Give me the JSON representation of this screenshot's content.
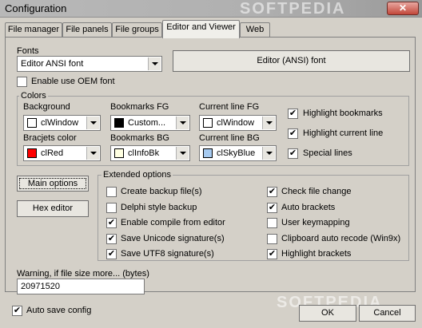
{
  "window": {
    "title": "Configuration",
    "close_glyph": "✕"
  },
  "tabs": [
    {
      "label": "File manager",
      "active": false
    },
    {
      "label": "File panels",
      "active": false
    },
    {
      "label": "File groups",
      "active": false
    },
    {
      "label": "Editor and Viewer",
      "active": true
    },
    {
      "label": "Web",
      "active": false
    }
  ],
  "fonts": {
    "label": "Fonts",
    "selected": "Editor ANSI font",
    "font_button": "Editor (ANSI) font",
    "oem_checkbox": {
      "label": "Enable use OEM font",
      "checked": false
    }
  },
  "colors": {
    "label": "Colors",
    "fields": [
      {
        "label": "Background",
        "value": "clWindow",
        "swatch": "#ffffff"
      },
      {
        "label": "Bookmarks FG",
        "value": "Custom...",
        "swatch": "#000000"
      },
      {
        "label": "Current line FG",
        "value": "clWindow",
        "swatch": "#ffffff"
      },
      {
        "label": "Bracjets color",
        "value": "clRed",
        "swatch": "#ff0000"
      },
      {
        "label": "Bookmarks BG",
        "value": "clInfoBk",
        "swatch": "#ffffe1"
      },
      {
        "label": "Current line BG",
        "value": "clSkyBlue",
        "swatch": "#a6caf0"
      }
    ],
    "checks": [
      {
        "label": "Highlight bookmarks",
        "checked": true
      },
      {
        "label": "Highlight current line",
        "checked": true
      },
      {
        "label": "Special lines",
        "checked": true
      }
    ]
  },
  "buttons": {
    "main_options": "Main options",
    "hex_editor": "Hex editor"
  },
  "extended": {
    "label": "Extended options",
    "left": [
      {
        "label": "Create backup file(s)",
        "checked": false
      },
      {
        "label": "Delphi style backup",
        "checked": false
      },
      {
        "label": "Enable compile from editor",
        "checked": true
      },
      {
        "label": "Save Unicode signature(s)",
        "checked": true
      },
      {
        "label": "Save UTF8 signature(s)",
        "checked": true
      }
    ],
    "right": [
      {
        "label": "Check file change",
        "checked": true
      },
      {
        "label": "Auto brackets",
        "checked": true
      },
      {
        "label": "User keymapping",
        "checked": false
      },
      {
        "label": "Clipboard auto recode (Win9x)",
        "checked": false
      },
      {
        "label": "Highlight brackets",
        "checked": true
      }
    ]
  },
  "warning": {
    "label": "Warning, if file size more... (bytes)",
    "value": "20971520"
  },
  "footer": {
    "auto_save": {
      "label": "Auto save config",
      "checked": true
    },
    "ok": "OK",
    "cancel": "Cancel"
  },
  "watermark": "SOFTPEDIA",
  "check_glyph": "✔"
}
